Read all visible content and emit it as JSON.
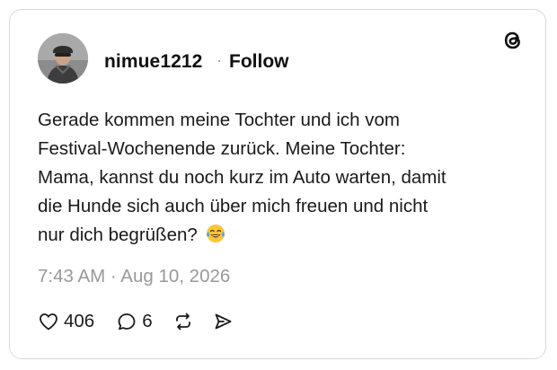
{
  "post": {
    "username": "nimue1212",
    "separator": "·",
    "follow_label": "Follow",
    "text_lines": [
      "Gerade kommen meine Tochter und ich vom",
      "Festival-Wochenende zurück. Meine Tochter:",
      "Mama, kannst du noch kurz im Auto warten, damit",
      "die Hunde sich auch über mich freuen und nicht",
      "nur dich begrüßen?"
    ],
    "emoji_icon": "face-with-tears-of-joy-icon",
    "timestamp": "7:43 AM · Aug 10, 2026",
    "likes": "406",
    "replies": "6"
  },
  "icons": {
    "logo": "threads-logo-icon",
    "like": "heart-icon",
    "reply": "speech-bubble-icon",
    "repost": "repost-icon",
    "share": "send-icon"
  },
  "colors": {
    "text": "#1a1a1a",
    "muted": "#999999",
    "border": "#d9d9d9"
  }
}
